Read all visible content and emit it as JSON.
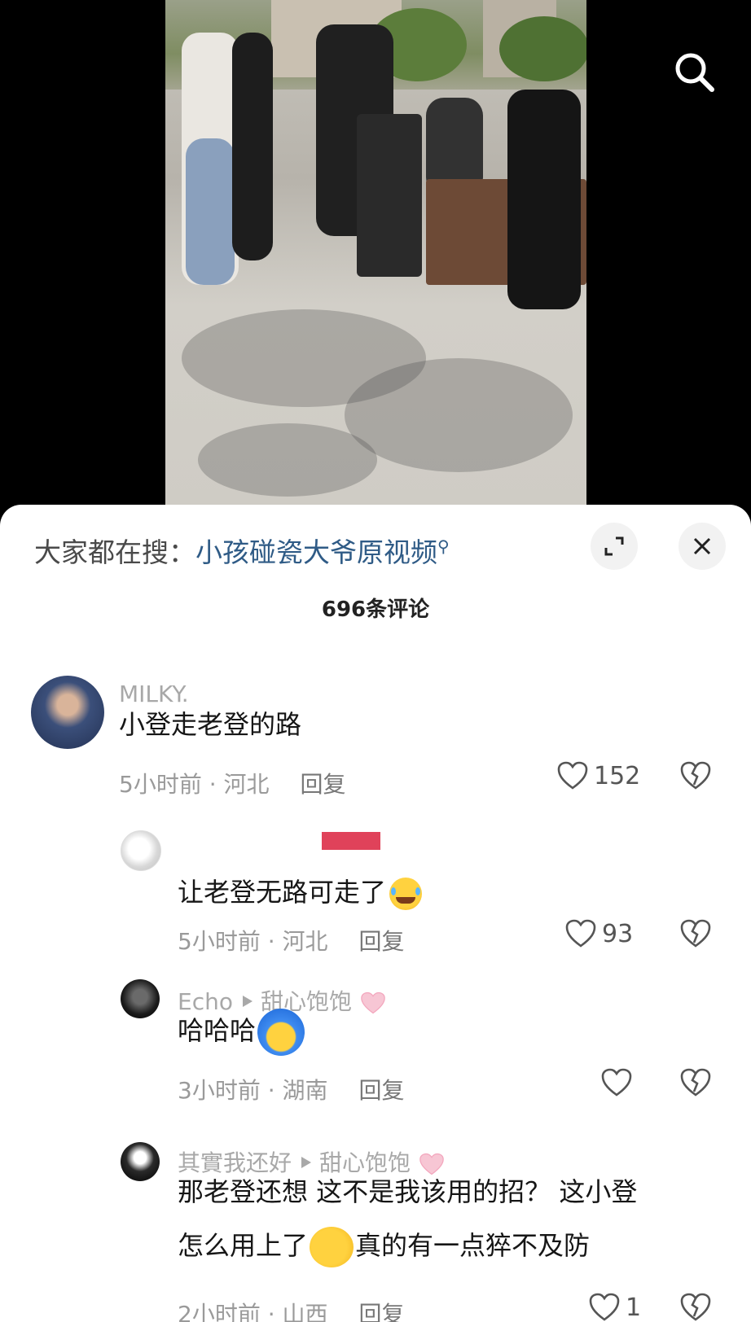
{
  "video": {
    "search_icon": "search-icon"
  },
  "sheet": {
    "trend_prefix": "大家都在搜：",
    "trend_query": "小孩碰瓷大爷原视频",
    "comment_count": "696条评论"
  },
  "comments": [
    {
      "username": "MILKY.",
      "text": "小登走老登的路",
      "time": "5小时前",
      "location": "河北",
      "reply": "回复",
      "likes": "152"
    },
    {
      "username": "",
      "text": "让老登无路可走了",
      "time": "5小时前",
      "location": "河北",
      "reply": "回复",
      "likes": "93"
    },
    {
      "username": "Echo",
      "reply_to": "甜心饱饱",
      "text": "哈哈哈",
      "time": "3小时前",
      "location": "湖南",
      "reply": "回复",
      "likes": ""
    },
    {
      "username": "其實我还好",
      "reply_to": "甜心饱饱",
      "text_line1": "那老登还想 这不是我该用的招？ 这小登",
      "text_line2a": "怎么用上了",
      "text_line2b": "真的有一点猝不及防",
      "time": "2小时前",
      "location": "山西",
      "reply": "回复",
      "likes": "1"
    }
  ],
  "colors": {
    "link": "#2f5b86",
    "accent_red": "#e0425a",
    "meta_gray": "#9a9a9a"
  }
}
